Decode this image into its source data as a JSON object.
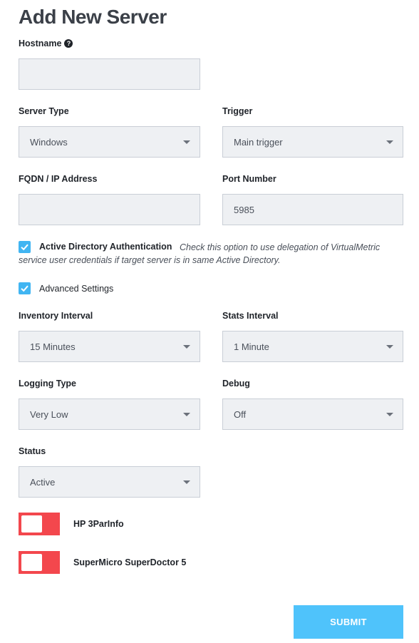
{
  "page_title": "Add New Server",
  "hostname": {
    "label": "Hostname",
    "help_icon": "?",
    "value": ""
  },
  "server_type": {
    "label": "Server Type",
    "value": "Windows"
  },
  "trigger": {
    "label": "Trigger",
    "value": "Main trigger"
  },
  "fqdn": {
    "label": "FQDN / IP Address",
    "value": ""
  },
  "port": {
    "label": "Port Number",
    "value": "5985"
  },
  "ad_auth": {
    "label": "Active Directory Authentication",
    "checked": true,
    "note_line1": "Check this option to use delegation of VirtualMetric",
    "note_line2": "service user credentials if target server is in same Active Directory."
  },
  "advanced": {
    "label": "Advanced Settings",
    "checked": true
  },
  "inventory_interval": {
    "label": "Inventory Interval",
    "value": "15 Minutes"
  },
  "stats_interval": {
    "label": "Stats Interval",
    "value": "1 Minute"
  },
  "logging_type": {
    "label": "Logging Type",
    "value": "Very Low"
  },
  "debug": {
    "label": "Debug",
    "value": "Off"
  },
  "status": {
    "label": "Status",
    "value": "Active"
  },
  "toggles": [
    {
      "label": "HP 3ParInfo",
      "on": false
    },
    {
      "label": "SuperMicro SuperDoctor 5",
      "on": false
    }
  ],
  "submit_label": "SUBMIT",
  "colors": {
    "accent": "#41b5f2",
    "submit": "#4fc3fb",
    "toggle_off": "#f3474d",
    "field_bg": "#eef0f3"
  }
}
